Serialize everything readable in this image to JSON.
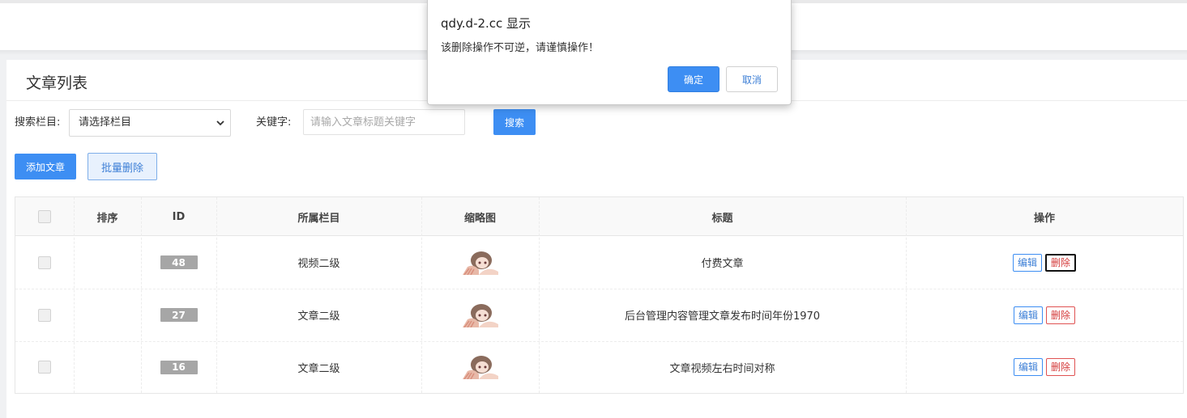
{
  "panel": {
    "title": "文章列表"
  },
  "filter": {
    "column_label": "搜索栏目:",
    "column_select_value": "请选择栏目",
    "keyword_label": "关键字:",
    "keyword_placeholder": "请输入文章标题关键字",
    "search_button": "搜索"
  },
  "toolbar": {
    "add_button": "添加文章",
    "batch_delete_button": "批量删除"
  },
  "table": {
    "headers": [
      "排序",
      "ID",
      "所属栏目",
      "缩略图",
      "标题",
      "操作"
    ],
    "rows": [
      {
        "id": "48",
        "category": "视频二级",
        "title": "付费文章",
        "edit": "编辑",
        "delete": "删除"
      },
      {
        "id": "27",
        "category": "文章二级",
        "title": "后台管理内容管理文章发布时间年份1970",
        "edit": "编辑",
        "delete": "删除"
      },
      {
        "id": "16",
        "category": "文章二级",
        "title": "文章视频左右时间对称",
        "edit": "编辑",
        "delete": "删除"
      }
    ]
  },
  "dialog": {
    "origin": "qdy.d-2.cc 显示",
    "message": "该删除操作不可逆，请谨慎操作！",
    "ok_button": "确定",
    "cancel_button": "取消"
  },
  "icons": {
    "select_arrow": "chevron-down-icon",
    "thumbnail": "anime-avatar-thumbnail"
  },
  "colors": {
    "primary": "#3d8ef3",
    "danger": "#d43b3b",
    "id_badge": "#a6a6a6"
  }
}
